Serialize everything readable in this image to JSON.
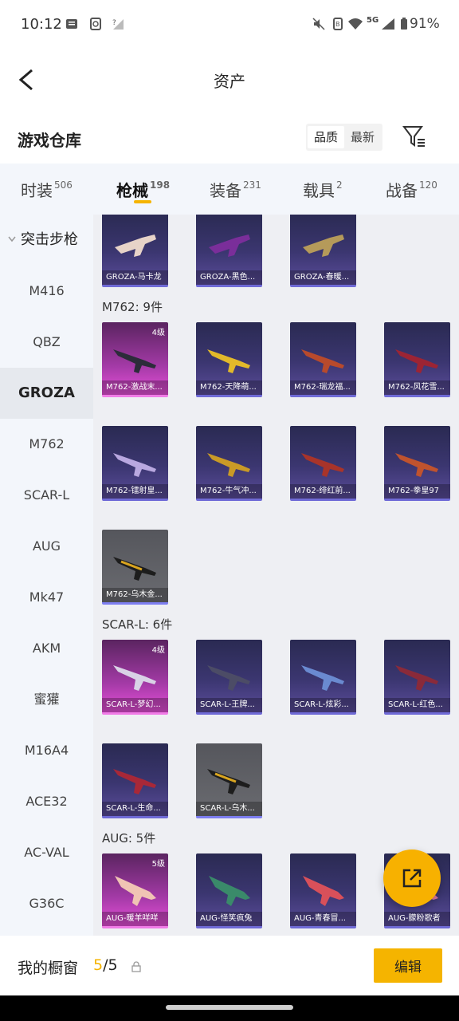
{
  "status_bar": {
    "time": "10:12",
    "battery": "91%",
    "network": "5G"
  },
  "header": {
    "title": "资产"
  },
  "warehouse": {
    "title": "游戏仓库",
    "sort_options": [
      "品质",
      "最新"
    ],
    "active_sort": "最新"
  },
  "tabs": [
    {
      "label": "时装",
      "count": "506"
    },
    {
      "label": "枪械",
      "count": "198"
    },
    {
      "label": "装备",
      "count": "231"
    },
    {
      "label": "载具",
      "count": "2"
    },
    {
      "label": "战备",
      "count": "120"
    }
  ],
  "subnav": {
    "group": "突击步枪",
    "items": [
      "M416",
      "QBZ",
      "GROZA",
      "M762",
      "SCAR-L",
      "AUG",
      "Mk47",
      "AKM",
      "蜜獾",
      "M16A4",
      "ACE32",
      "AC-VAL",
      "G36C"
    ],
    "active": "GROZA"
  },
  "sections": {
    "groza": {
      "items": [
        "GROZA-马卡龙",
        "GROZA-黑色...",
        "GROZA-春暖..."
      ]
    },
    "m762": {
      "label": "M762: 9件",
      "items": [
        "M762-激战末...",
        "M762-天降萌...",
        "M762-瑞龙福...",
        "M762-风花雪...",
        "M762-镭射皇...",
        "M762-牛气冲...",
        "M762-绯红前...",
        "M762-拳皇97",
        "M762-乌木金..."
      ],
      "levels": [
        "4级"
      ]
    },
    "scarl": {
      "label": "SCAR-L: 6件",
      "items": [
        "SCAR-L-梦幻...",
        "SCAR-L-王牌...",
        "SCAR-L-炫彩...",
        "SCAR-L-红色...",
        "SCAR-L-生命...",
        "SCAR-L-乌木..."
      ],
      "levels": [
        "4级"
      ]
    },
    "aug": {
      "label": "AUG: 5件",
      "items": [
        "AUG-暖羊咩咩",
        "AUG-怪笑疯兔",
        "AUG-青春冒...",
        "AUG-朦粉歌者"
      ],
      "levels": [
        "5级"
      ]
    }
  },
  "showcase": {
    "label": "我的橱窗",
    "current": "5",
    "total": "/5",
    "edit_label": "编辑"
  },
  "colors": {
    "accent": "#f5b400",
    "card_bg": "#3b3670",
    "card_pink": "#a33aa6"
  }
}
